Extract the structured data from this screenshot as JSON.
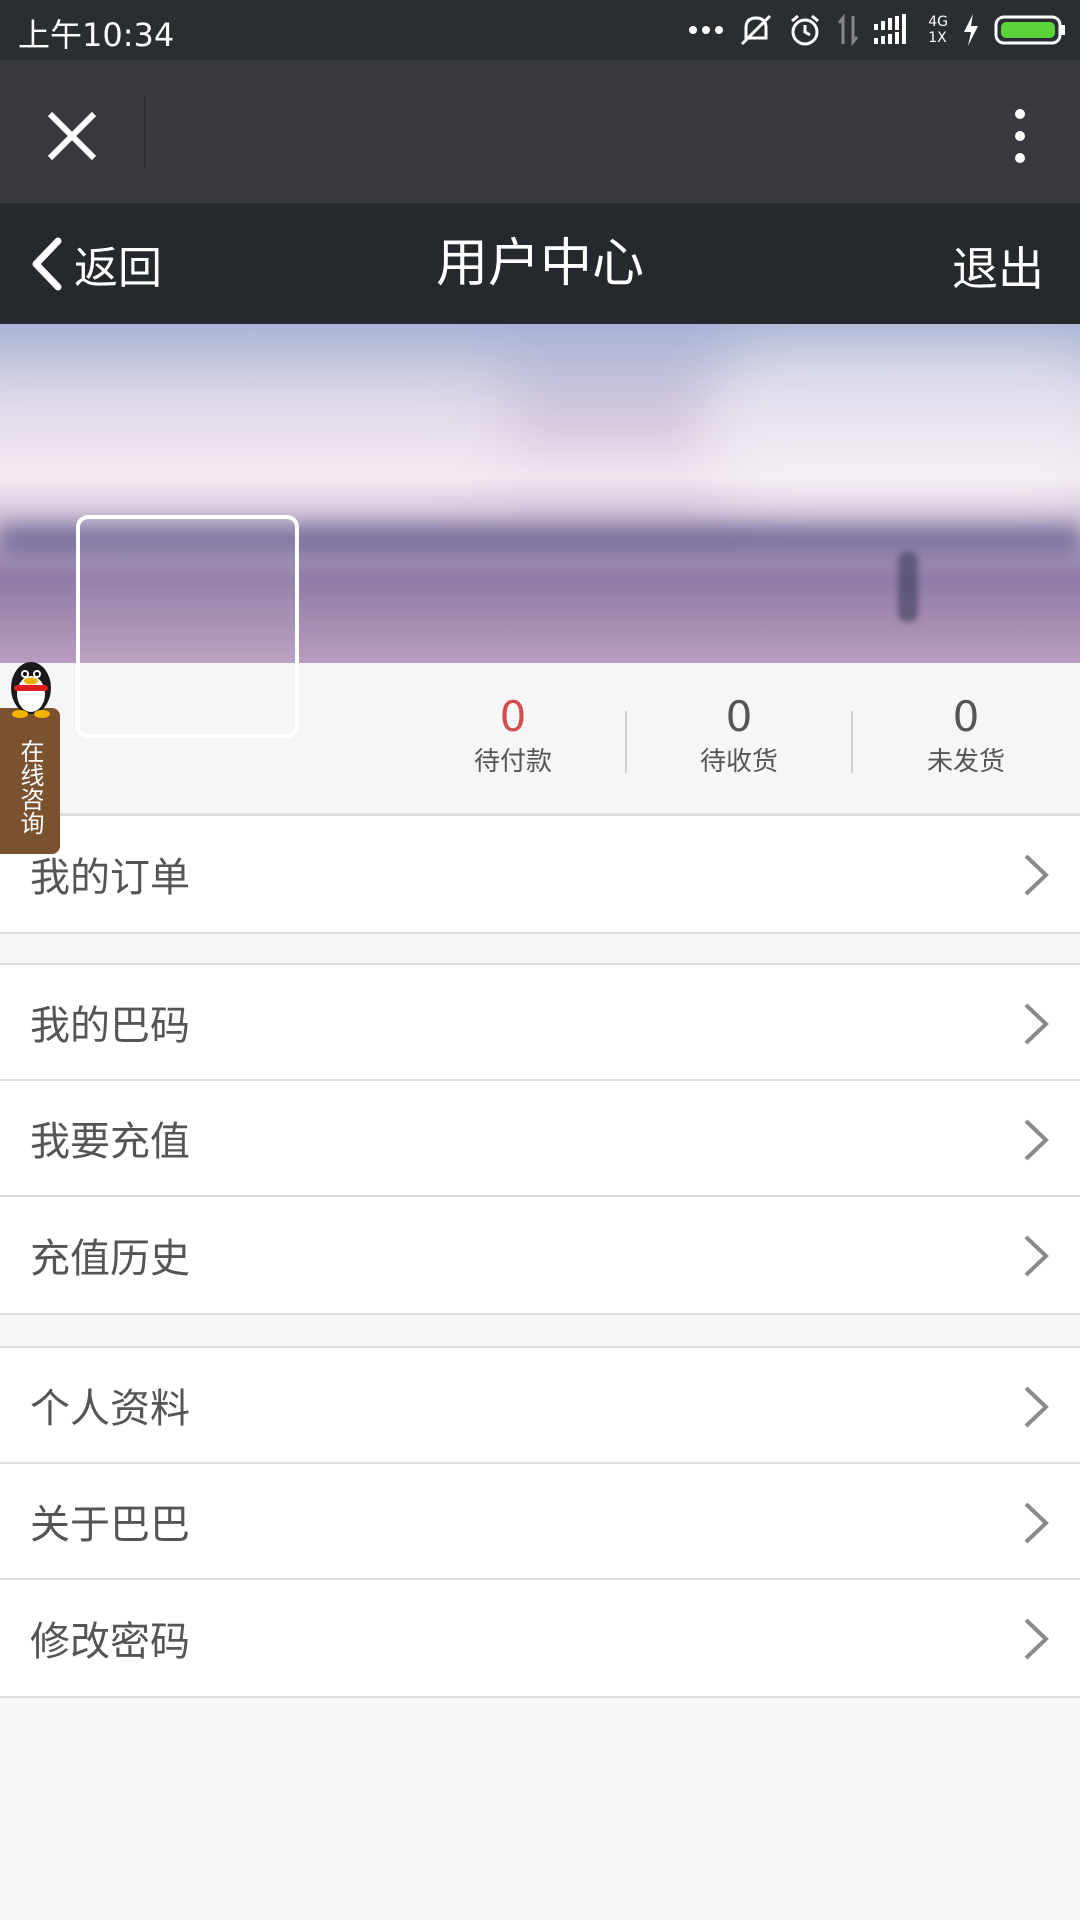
{
  "status_bar": {
    "time": "上午10:34",
    "network_label": "4G",
    "network_sublabel": "1X"
  },
  "browser_bar": {
    "close_icon": "close-icon",
    "more_icon": "more-vertical-icon"
  },
  "header": {
    "back_label": "返回",
    "title": "用户中心",
    "logout_label": "退出"
  },
  "stats": [
    {
      "value": "0",
      "label": "待付款",
      "color": "#d24d4d"
    },
    {
      "value": "0",
      "label": "待收货",
      "color": "#555555"
    },
    {
      "value": "0",
      "label": "未发货",
      "color": "#555555"
    }
  ],
  "qq_consult": {
    "label": "在线咨询"
  },
  "menu": {
    "group1": [
      {
        "label": "我的订单"
      }
    ],
    "group2": [
      {
        "label": "我的巴码"
      },
      {
        "label": "我要充值"
      },
      {
        "label": "充值历史"
      }
    ],
    "group3": [
      {
        "label": "个人资料"
      },
      {
        "label": "关于巴巴"
      },
      {
        "label": "修改密码"
      }
    ]
  }
}
